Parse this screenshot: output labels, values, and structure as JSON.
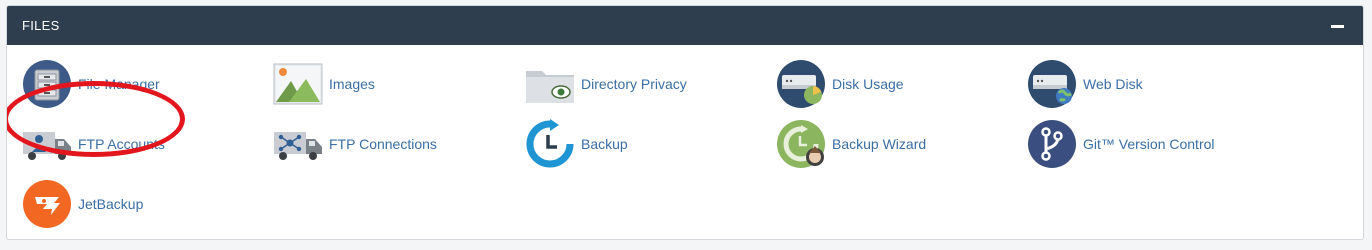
{
  "section": {
    "title": "FILES",
    "collapse_icon": "minus-icon"
  },
  "items": [
    {
      "label": "File Manager",
      "icon": "file-cabinet-icon"
    },
    {
      "label": "Images",
      "icon": "image-icon"
    },
    {
      "label": "Directory Privacy",
      "icon": "folder-eye-icon"
    },
    {
      "label": "Disk Usage",
      "icon": "disk-usage-icon"
    },
    {
      "label": "Web Disk",
      "icon": "web-disk-icon"
    },
    {
      "label": "FTP Accounts",
      "icon": "ftp-truck-user-icon"
    },
    {
      "label": "FTP Connections",
      "icon": "ftp-truck-network-icon"
    },
    {
      "label": "Backup",
      "icon": "backup-clock-icon"
    },
    {
      "label": "Backup Wizard",
      "icon": "backup-wizard-icon"
    },
    {
      "label": "Git™ Version Control",
      "icon": "git-branch-icon"
    },
    {
      "label": "JetBackup",
      "icon": "jetbackup-logo-icon"
    }
  ],
  "colors": {
    "header_bg": "#2f3e4f",
    "link": "#3a6ea5",
    "highlight": "#e3161e"
  }
}
